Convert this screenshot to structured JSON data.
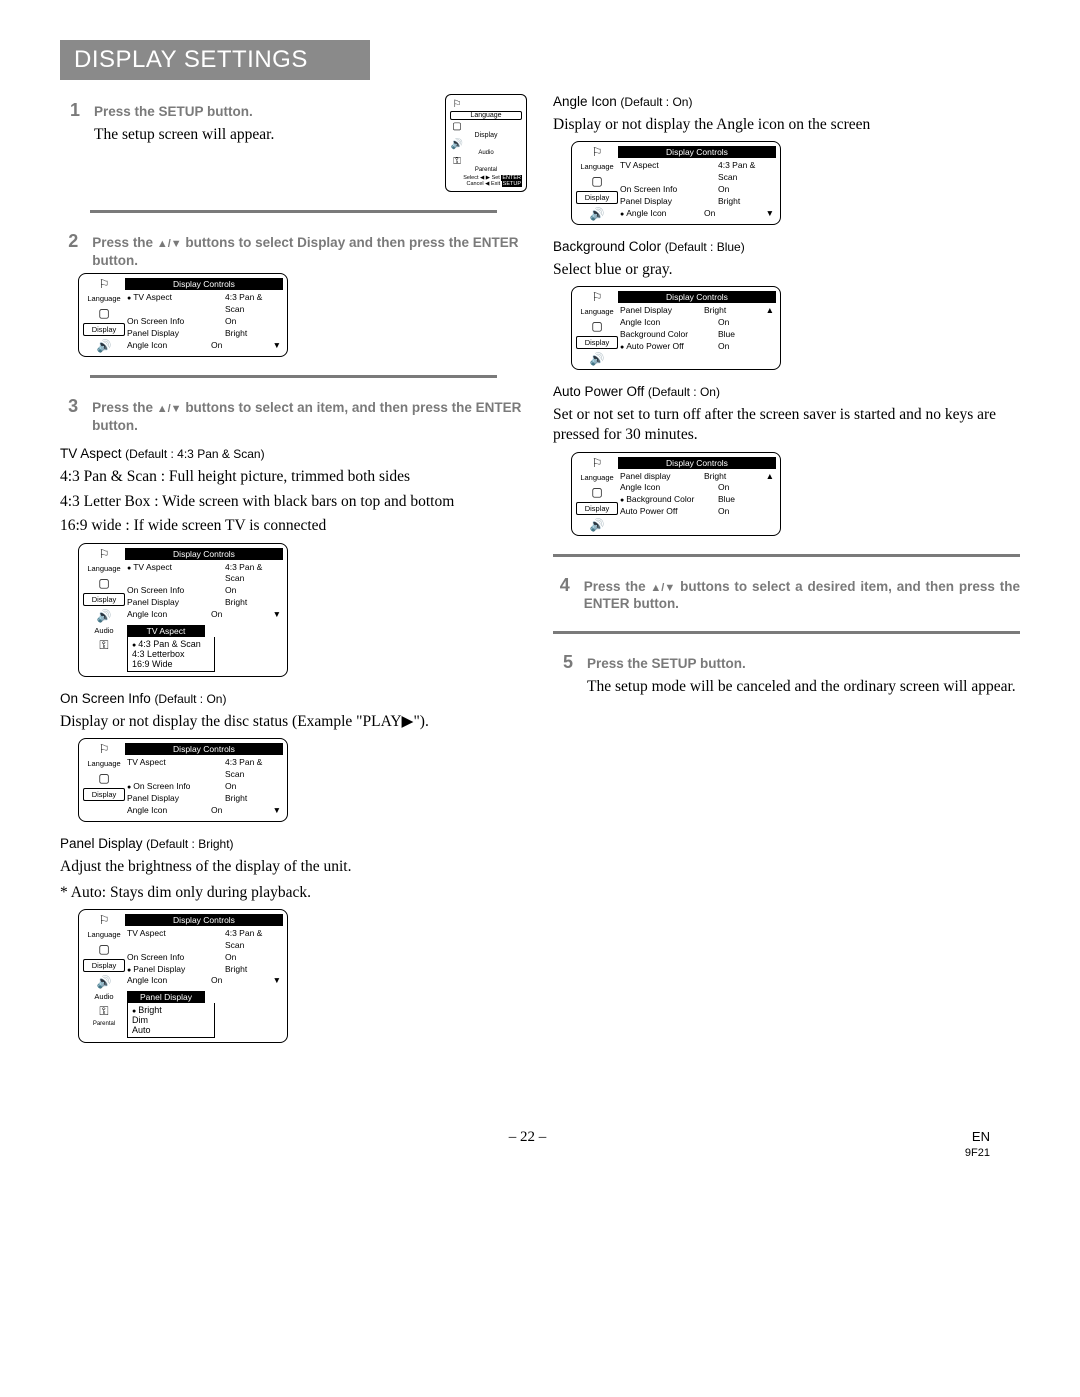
{
  "title": "DISPLAY SETTINGS",
  "steps": {
    "s1": {
      "num": "1",
      "text": "Press the SETUP button."
    },
    "s1_body": "The setup screen will appear.",
    "s2": {
      "num": "2",
      "text_a": "Press the ",
      "text_b": " buttons to select Display and then press the ENTER button."
    },
    "s3": {
      "num": "3",
      "text_a": "Press the ",
      "text_b": " buttons to select an item, and then press the ENTER button."
    },
    "s4": {
      "num": "4",
      "text_a": "Press the ",
      "text_b": " buttons to select a desired item, and then press the ENTER button."
    },
    "s5": {
      "num": "5",
      "text": "Press the SETUP button."
    },
    "s5_body": "The setup mode will be canceled and the ordinary screen will appear."
  },
  "tvaspect": {
    "label": "TV Aspect",
    "default": "(Default : 4:3 Pan & Scan)",
    "l1": "4:3 Pan & Scan : Full height picture, trimmed both sides",
    "l2": "4:3 Letter Box : Wide screen with black bars on top and bottom",
    "l3": "16:9 wide : If wide screen TV is connected"
  },
  "onscreen": {
    "label": "On Screen Info",
    "default": "(Default : On)",
    "l1": "Display or not display the disc status (Example \"PLAY▶\")."
  },
  "panel": {
    "label": "Panel Display",
    "default": "(Default : Bright)",
    "l1": "Adjust the brightness of the display of the unit.",
    "l2": "* Auto: Stays dim only during playback."
  },
  "angle": {
    "label": "Angle Icon",
    "default": "(Default : On)",
    "l1": "Display or not display the Angle icon on the screen"
  },
  "bg": {
    "label": "Background Color",
    "default": "(Default : Blue)",
    "l1": "Select blue or gray."
  },
  "auto": {
    "label": "Auto Power Off",
    "default": "(Default : On)",
    "l1": "Set or not set to turn off after the screen saver is started and no keys are pressed for 30 minutes."
  },
  "osd": {
    "menu_title": "Display Controls",
    "side": {
      "language": "Language",
      "display": "Display",
      "audio": "Audio",
      "parental": "Parental"
    },
    "rows": {
      "tv": {
        "k": "TV Aspect",
        "v": "4:3 Pan & Scan"
      },
      "osi": {
        "k": "On Screen Info",
        "v": "On"
      },
      "pd": {
        "k": "Panel Display",
        "v": "Bright"
      },
      "ai": {
        "k": "Angle Icon",
        "v": "On"
      },
      "bg": {
        "k": "Background Color",
        "v": "Blue"
      },
      "apo": {
        "k": "Auto Power Off",
        "v": "On"
      },
      "pd2": {
        "k": "Panel display",
        "v": "Bright"
      }
    },
    "tv_sub": {
      "title": "TV Aspect",
      "o1": "4:3 Pan & Scan",
      "o2": "4:3 Letterbox",
      "o3": "16:9 Wide"
    },
    "pd_sub": {
      "title": "Panel  Display",
      "o1": "Bright",
      "o2": "Dim",
      "o3": "Auto"
    },
    "hint": {
      "select": "Select",
      "set": "Set",
      "enter": "ENTER",
      "cancel": "Cancel",
      "exit": "Exit",
      "setup": "SETUP"
    }
  },
  "footer": {
    "page": "– 22 –",
    "lang": "EN",
    "code": "9F21"
  }
}
